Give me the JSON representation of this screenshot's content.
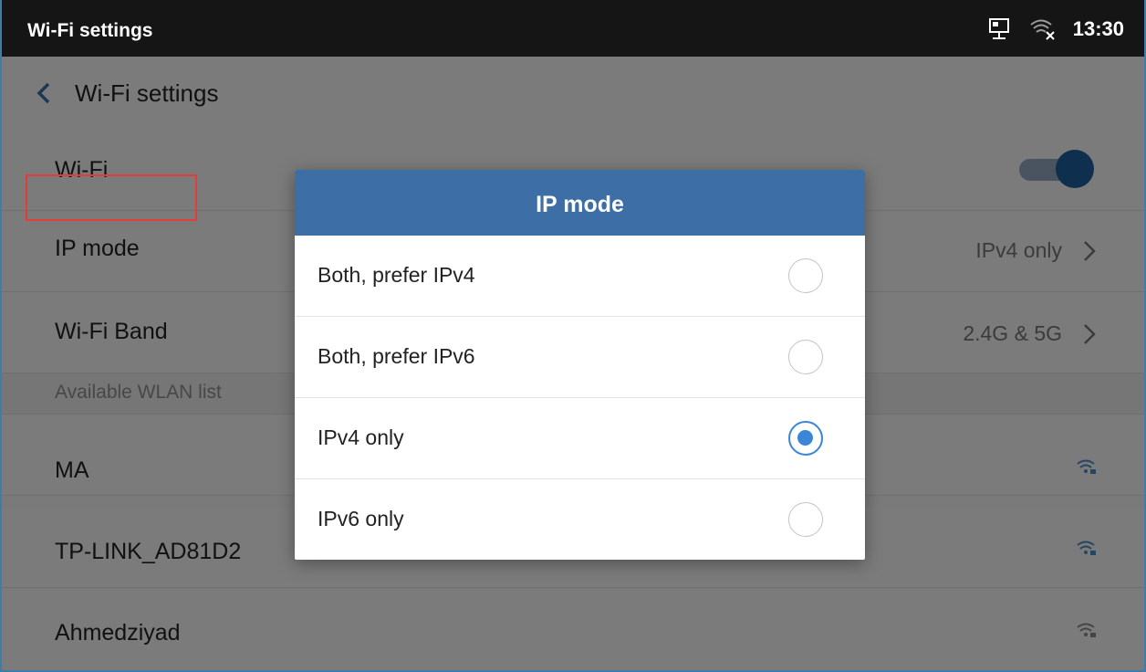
{
  "statusbar": {
    "title": "Wi-Fi settings",
    "time": "13:30",
    "icons": [
      "network-icon",
      "wifi-off-icon"
    ]
  },
  "appbar": {
    "title": "Wi-Fi settings",
    "back_icon": "chevron-left-icon"
  },
  "settings": {
    "wifi_label": "Wi-Fi",
    "wifi_enabled": true,
    "ip_mode_label": "IP mode",
    "ip_mode_value": "IPv4 only",
    "band_label": "Wi-Fi Band",
    "band_value": "2.4G & 5G"
  },
  "wlan": {
    "section_label": "Available WLAN list",
    "networks": [
      "MA",
      "TP-LINK_AD81D2",
      "Ahmedziyad"
    ]
  },
  "dialog": {
    "title": "IP mode",
    "options": [
      {
        "label": "Both, prefer IPv4",
        "selected": false
      },
      {
        "label": "Both, prefer IPv6",
        "selected": false
      },
      {
        "label": "IPv4 only",
        "selected": true
      },
      {
        "label": "IPv6 only",
        "selected": false
      }
    ]
  },
  "colors": {
    "accent": "#3d6ea5",
    "radio_selected": "#3b86d6",
    "highlight": "#e53b3b",
    "statusbar": "#151515"
  }
}
